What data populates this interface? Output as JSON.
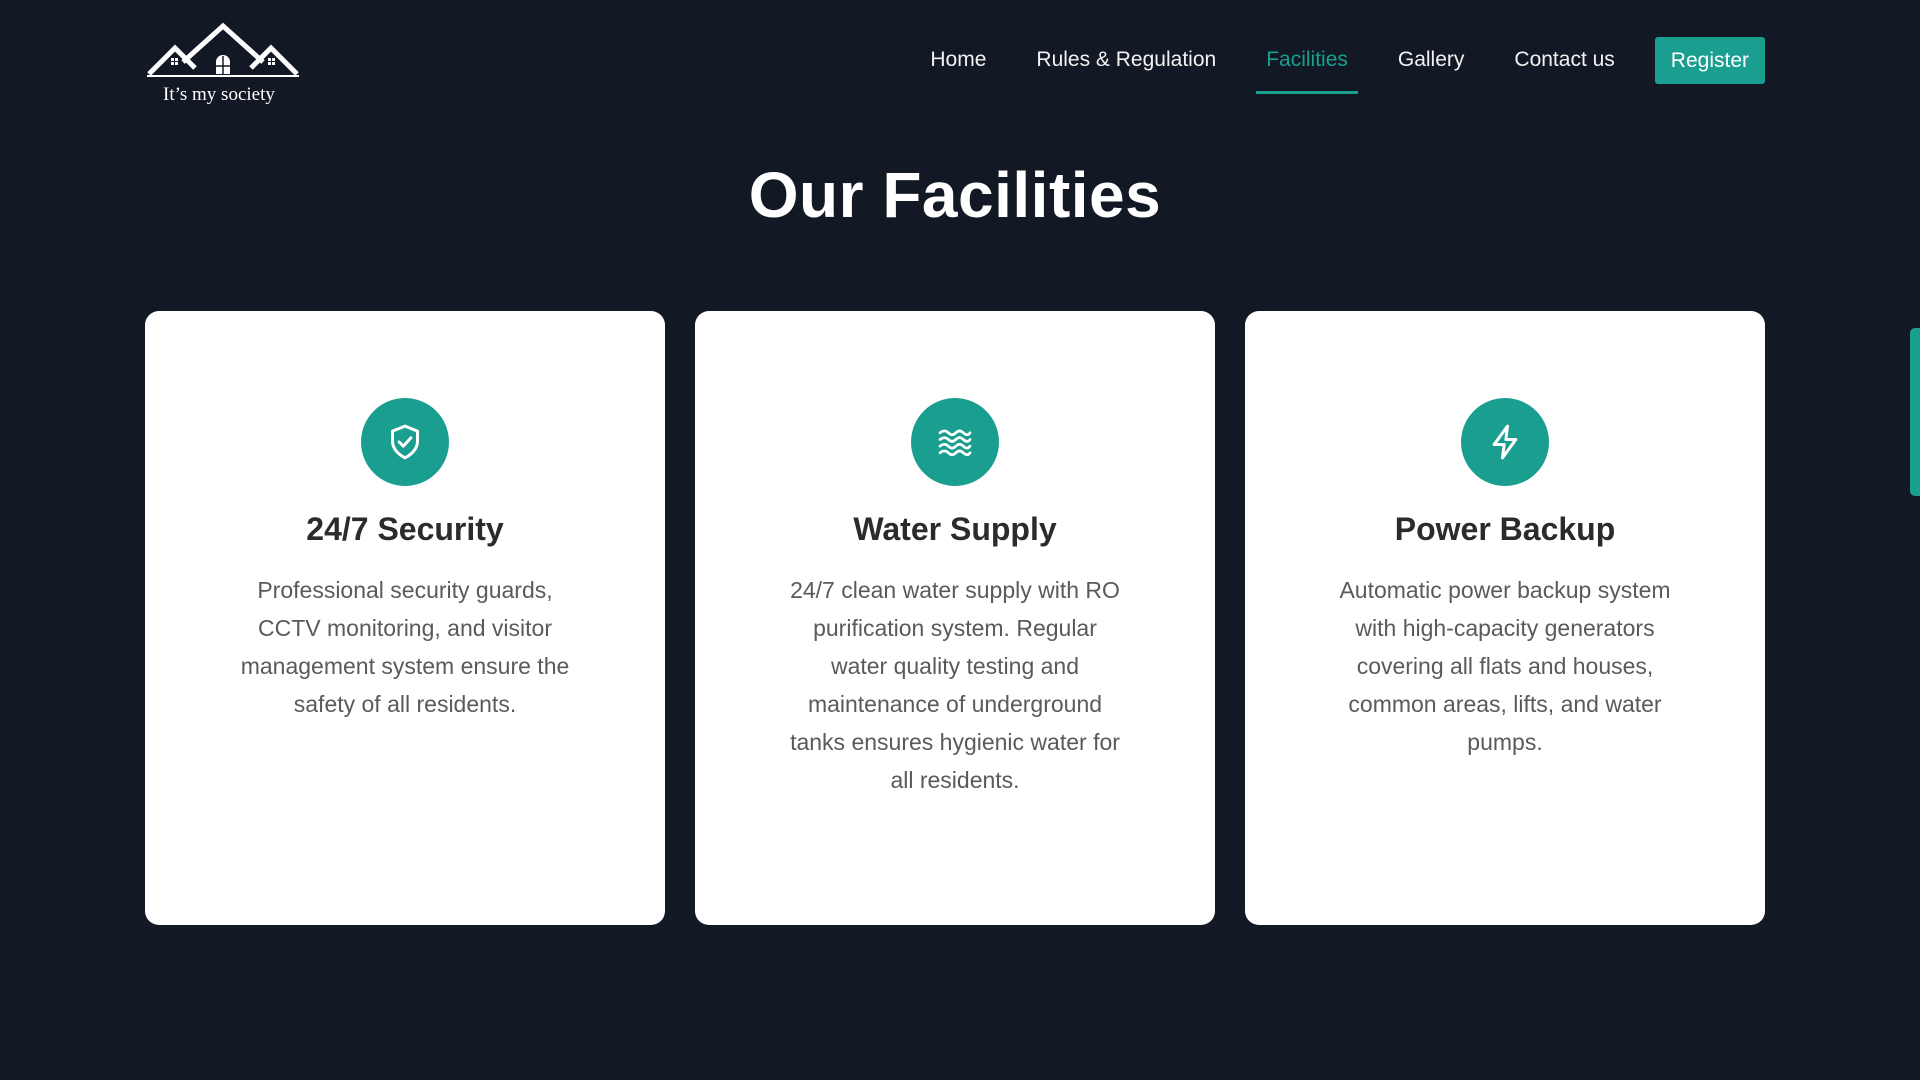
{
  "header": {
    "logo_text": "It’s my society",
    "nav": {
      "home": "Home",
      "rules": "Rules & Regulation",
      "facilities": "Facilities",
      "gallery": "Gallery",
      "contact": "Contact us"
    },
    "register_label": "Register"
  },
  "main": {
    "title": "Our Facilities",
    "cards": [
      {
        "icon": "shield-check-icon",
        "title": "24/7 Security",
        "description": "Professional security guards, CCTV monitoring, and visitor management system ensure the safety of all residents."
      },
      {
        "icon": "water-waves-icon",
        "title": "Water Supply",
        "description": "24/7 clean water supply with RO purification system. Regular water quality testing and maintenance of underground tanks ensures hygienic water for all residents."
      },
      {
        "icon": "lightning-bolt-icon",
        "title": "Power Backup",
        "description": "Automatic power backup system with high-capacity generators covering all flats and houses, common areas, lifts, and water pumps."
      }
    ]
  },
  "colors": {
    "background": "#121924",
    "accent": "#1a9e8f",
    "card": "#ffffff"
  }
}
